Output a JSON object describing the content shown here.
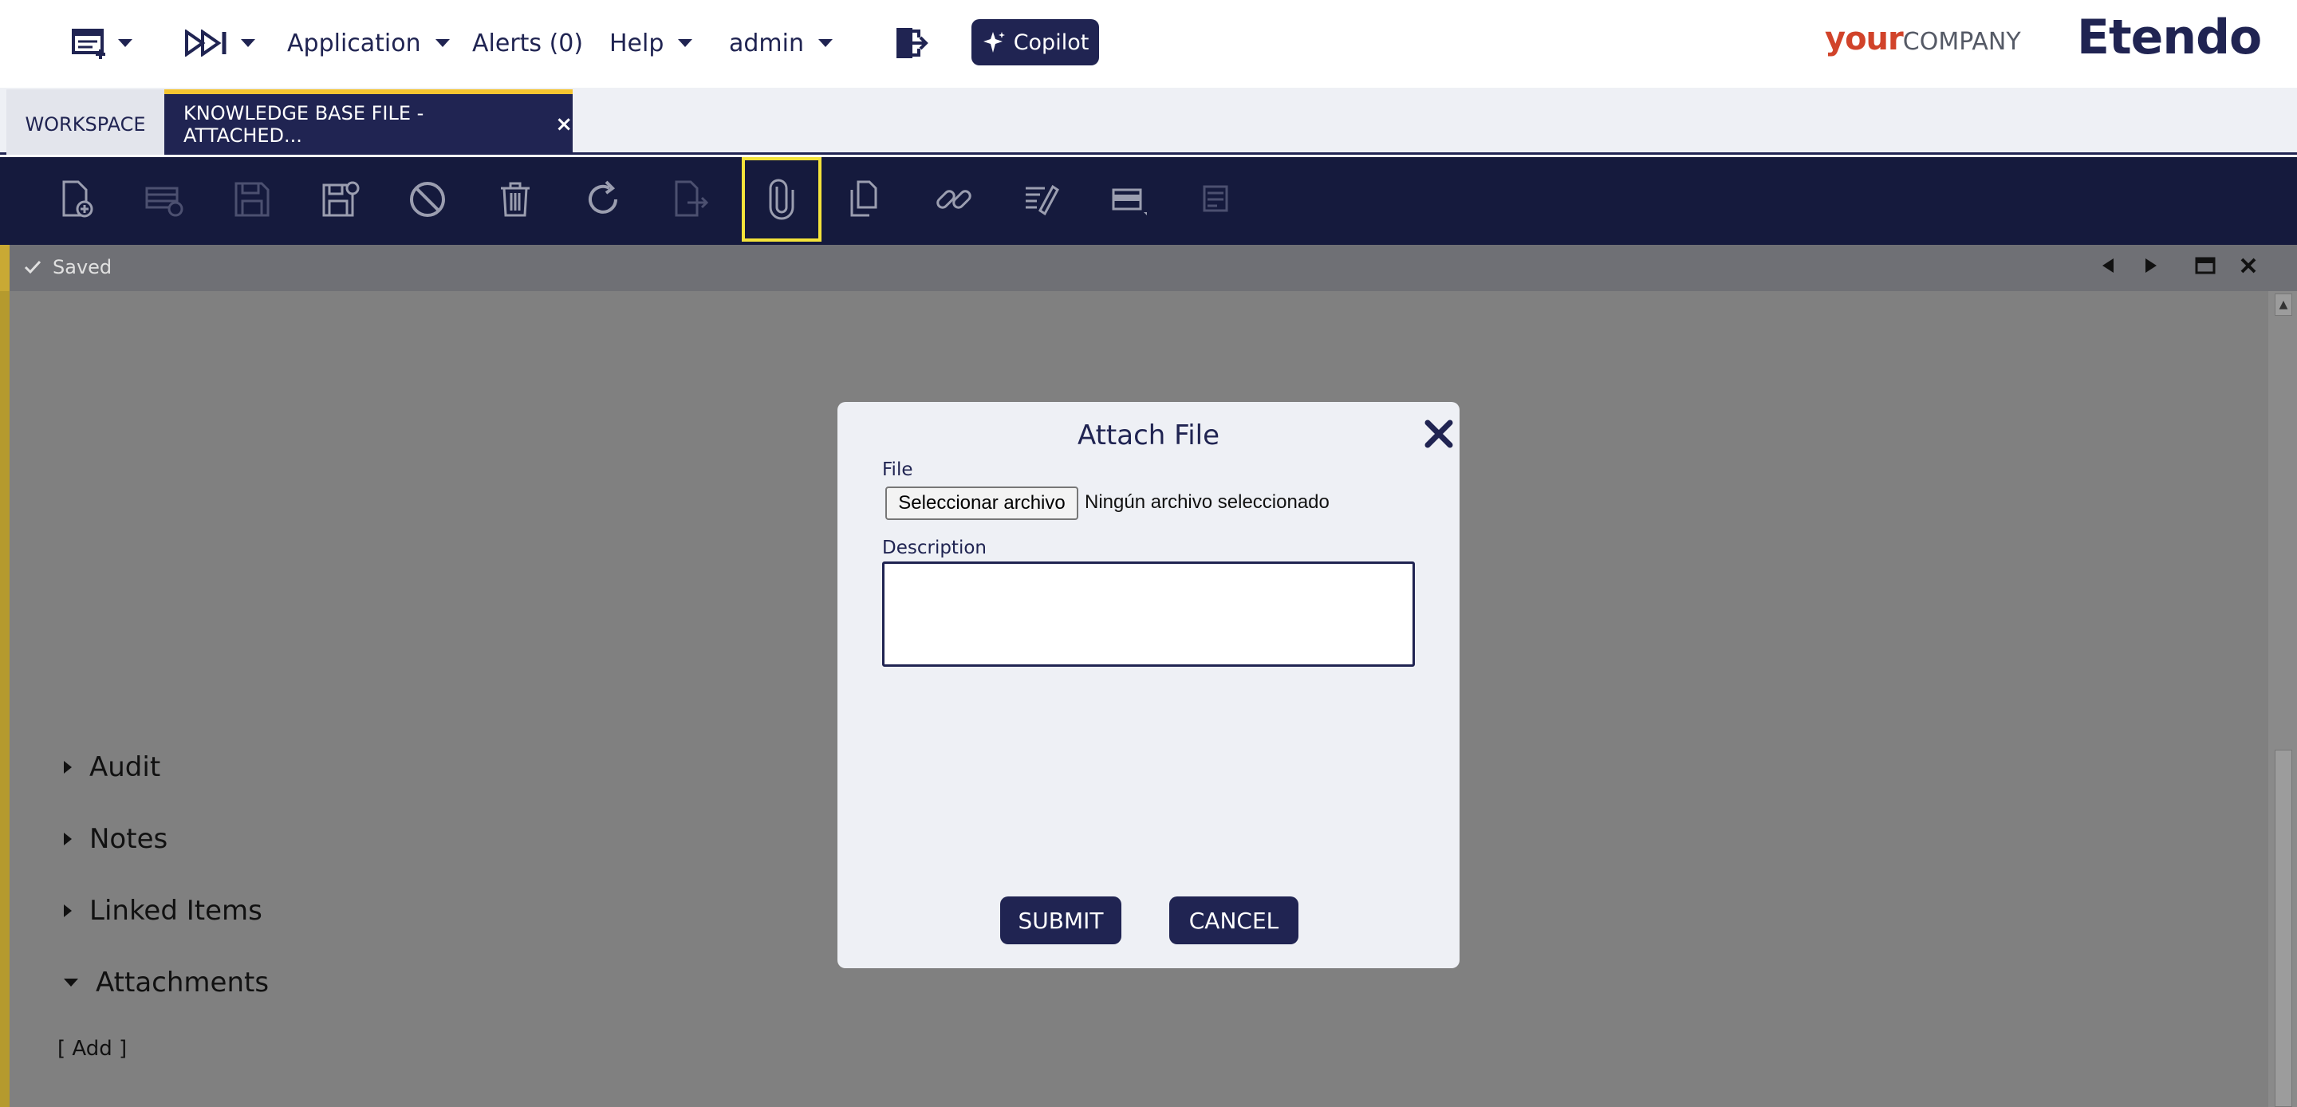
{
  "nav": {
    "application": "Application",
    "alerts": "Alerts (0)",
    "help": "Help",
    "user": "admin",
    "copilot": "Copilot"
  },
  "brand": {
    "your": "your",
    "company": "COMPANY",
    "etendo": "Etendo"
  },
  "tabs": {
    "workspace": "WORKSPACE",
    "active": "KNOWLEDGE BASE FILE - ATTACHED...",
    "close": "×"
  },
  "status": {
    "saved": "Saved"
  },
  "sections": {
    "audit": "Audit",
    "notes": "Notes",
    "linked_items": "Linked Items",
    "attachments": "Attachments",
    "add": "[ Add ]"
  },
  "modal": {
    "title": "Attach File",
    "file_label": "File",
    "file_button": "Seleccionar archivo",
    "file_status": "Ningún archivo seleccionado",
    "description_label": "Description",
    "description_value": "",
    "submit": "SUBMIT",
    "cancel": "CANCEL"
  },
  "colors": {
    "primary": "#202452",
    "toolbar": "#151a3d",
    "accent": "#f4c430",
    "highlight": "#f4e33a",
    "brand_red": "#d1432a"
  }
}
